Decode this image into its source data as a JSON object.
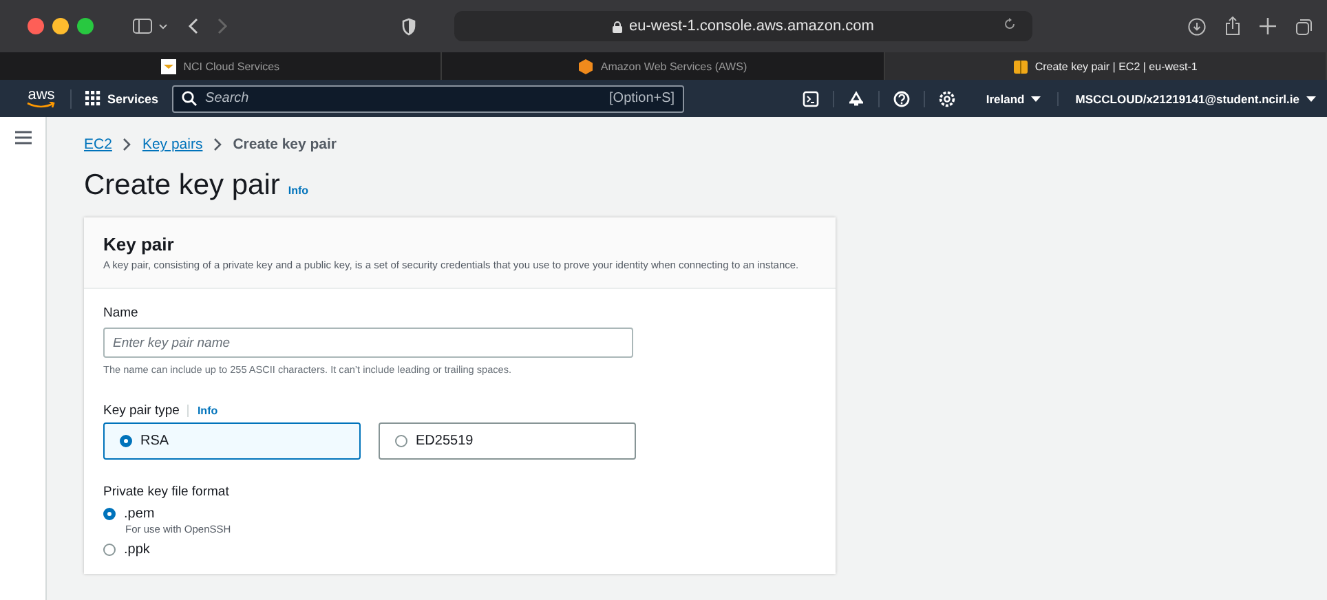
{
  "browser": {
    "url": "eu-west-1.console.aws.amazon.com",
    "tabs": [
      {
        "label": "NCI Cloud Services",
        "selected": false
      },
      {
        "label": "Amazon Web Services (AWS)",
        "selected": false
      },
      {
        "label": "Create key pair | EC2 | eu-west-1",
        "selected": true
      }
    ]
  },
  "nav": {
    "logo": "aws",
    "services": "Services",
    "search_placeholder": "Search",
    "shortcut": "[Option+S]",
    "region": "Ireland",
    "account": "MSCCLOUD/x21219141@student.ncirl.ie"
  },
  "breadcrumbs": [
    {
      "label": "EC2",
      "kind": "link"
    },
    {
      "label": "Key pairs",
      "kind": "link"
    },
    {
      "label": "Create key pair",
      "kind": "current"
    }
  ],
  "title": "Create key pair",
  "title_info": "Info",
  "card": {
    "heading": "Key pair",
    "description": "A key pair, consisting of a private key and a public key, is a set of security credentials that you use to prove your identity when connecting to an instance.",
    "name_label": "Name",
    "name_placeholder": "Enter key pair name",
    "name_hint": "The name can include up to 255 ASCII characters. It can’t include leading or trailing spaces.",
    "type_label": "Key pair type",
    "type_info": "Info",
    "types": [
      {
        "label": "RSA",
        "selected": true
      },
      {
        "label": "ED25519",
        "selected": false
      }
    ],
    "format_label": "Private key file format",
    "formats": [
      {
        "label": ".pem",
        "description": "For use with OpenSSH",
        "selected": true
      },
      {
        "label": ".ppk",
        "selected": false
      }
    ]
  }
}
